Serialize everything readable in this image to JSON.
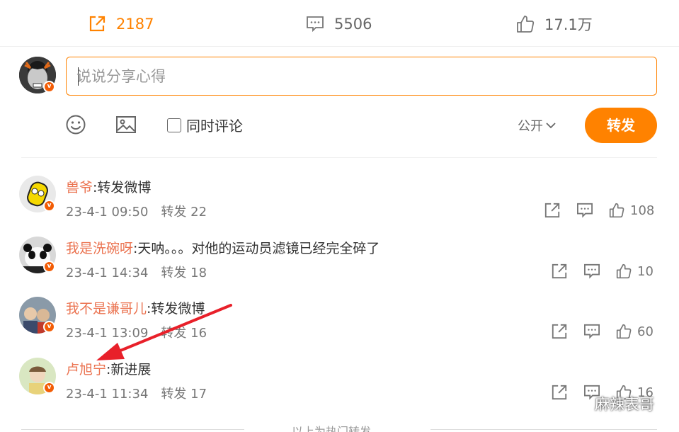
{
  "stats": {
    "repost_count": "2187",
    "comment_count": "5506",
    "like_count": "17.1万"
  },
  "composer": {
    "placeholder": "说说分享心得",
    "also_comment_label": "同时评论",
    "visibility_label": "公开",
    "submit_label": "转发"
  },
  "reposts": [
    {
      "name": "兽爷",
      "text": ":转发微博",
      "time": "23-4-1 09:50",
      "repost_label": "转发 22",
      "likes": "108"
    },
    {
      "name": "我是洗碗呀",
      "text": ":天呐。。。对他的运动员滤镜已经完全碎了",
      "time": "23-4-1 14:34",
      "repost_label": "转发 18",
      "likes": "10"
    },
    {
      "name": "我不是谦哥儿",
      "text": ":转发微博",
      "time": "23-4-1 13:09",
      "repost_label": "转发 16",
      "likes": "60"
    },
    {
      "name": "卢旭宁",
      "text": ":新进展",
      "time": "23-4-1 11:34",
      "repost_label": "转发 17",
      "likes": "16"
    }
  ],
  "footer_text": "以上为热门转发",
  "watermark": "麻辣表哥",
  "colors": {
    "accent": "#ff8200",
    "username": "#eb7350",
    "annotation": "#e8202a"
  }
}
